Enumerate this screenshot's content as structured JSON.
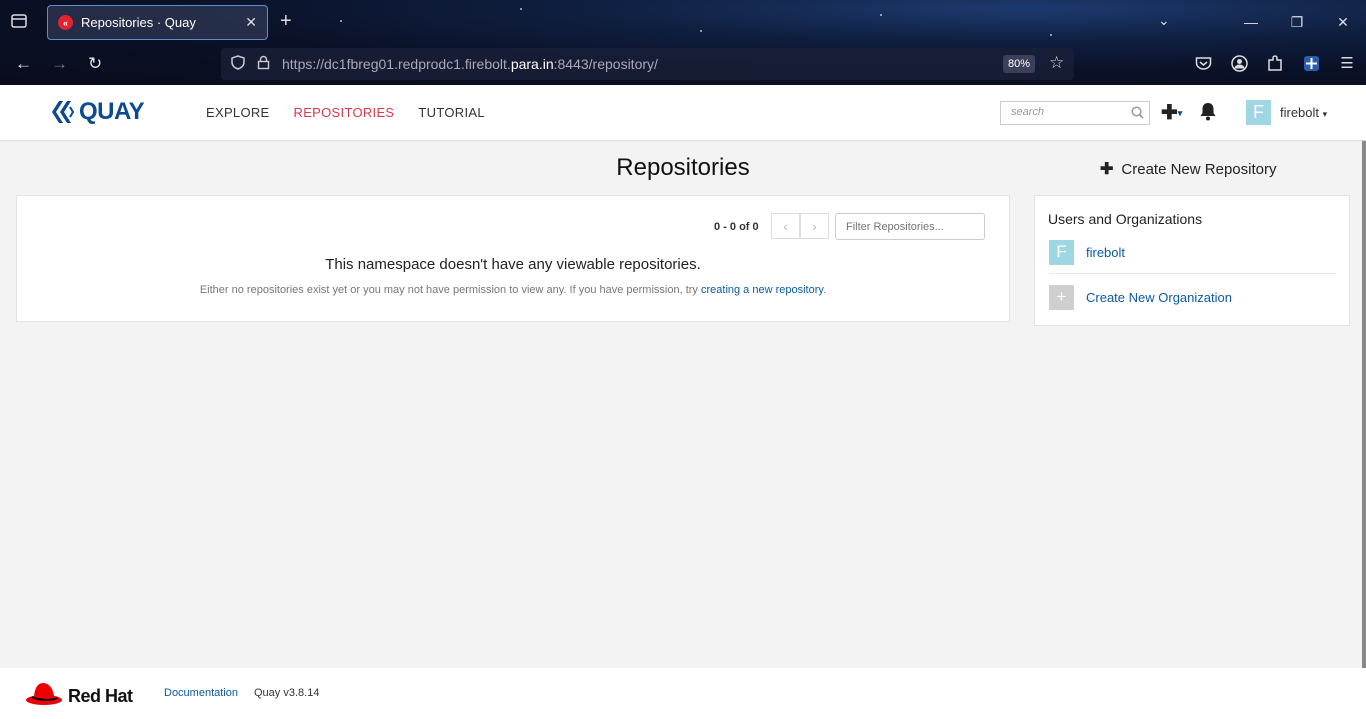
{
  "browser": {
    "tab_title": "Repositories · Quay",
    "url_prefix": "https://dc1fbreg01.redprodc1.firebolt.",
    "url_domain": "para.in",
    "url_suffix": ":8443/repository/",
    "zoom": "80%"
  },
  "header": {
    "logo_text": "QUAY",
    "nav": [
      {
        "label": "EXPLORE",
        "active": false
      },
      {
        "label": "REPOSITORIES",
        "active": true
      },
      {
        "label": "TUTORIAL",
        "active": false
      }
    ],
    "search_placeholder": "search",
    "user_initial": "F",
    "user_name": "firebolt"
  },
  "main": {
    "title": "Repositories",
    "create_repo_label": "Create New Repository",
    "pager_count": "0 - 0 of 0",
    "filter_placeholder": "Filter Repositories...",
    "empty_title": "This namespace doesn't have any viewable repositories.",
    "empty_sub_prefix": "Either no repositories exist yet or you may not have permission to view any. If you have permission, try ",
    "empty_sub_link": "creating a new repository",
    "empty_sub_suffix": "."
  },
  "sidebar": {
    "heading": "Users and Organizations",
    "user_initial": "F",
    "user_name": "firebolt",
    "create_org_label": "Create New Organization",
    "user_avatar_color": "#9ed6e3",
    "org_avatar_color": "#cfcfcf"
  },
  "footer": {
    "brand": "Red Hat",
    "documentation": "Documentation",
    "version": "Quay v3.8.14"
  },
  "colors": {
    "accent": "#d9374a",
    "link": "#0c5aa6",
    "brand": "#0c4a93"
  }
}
